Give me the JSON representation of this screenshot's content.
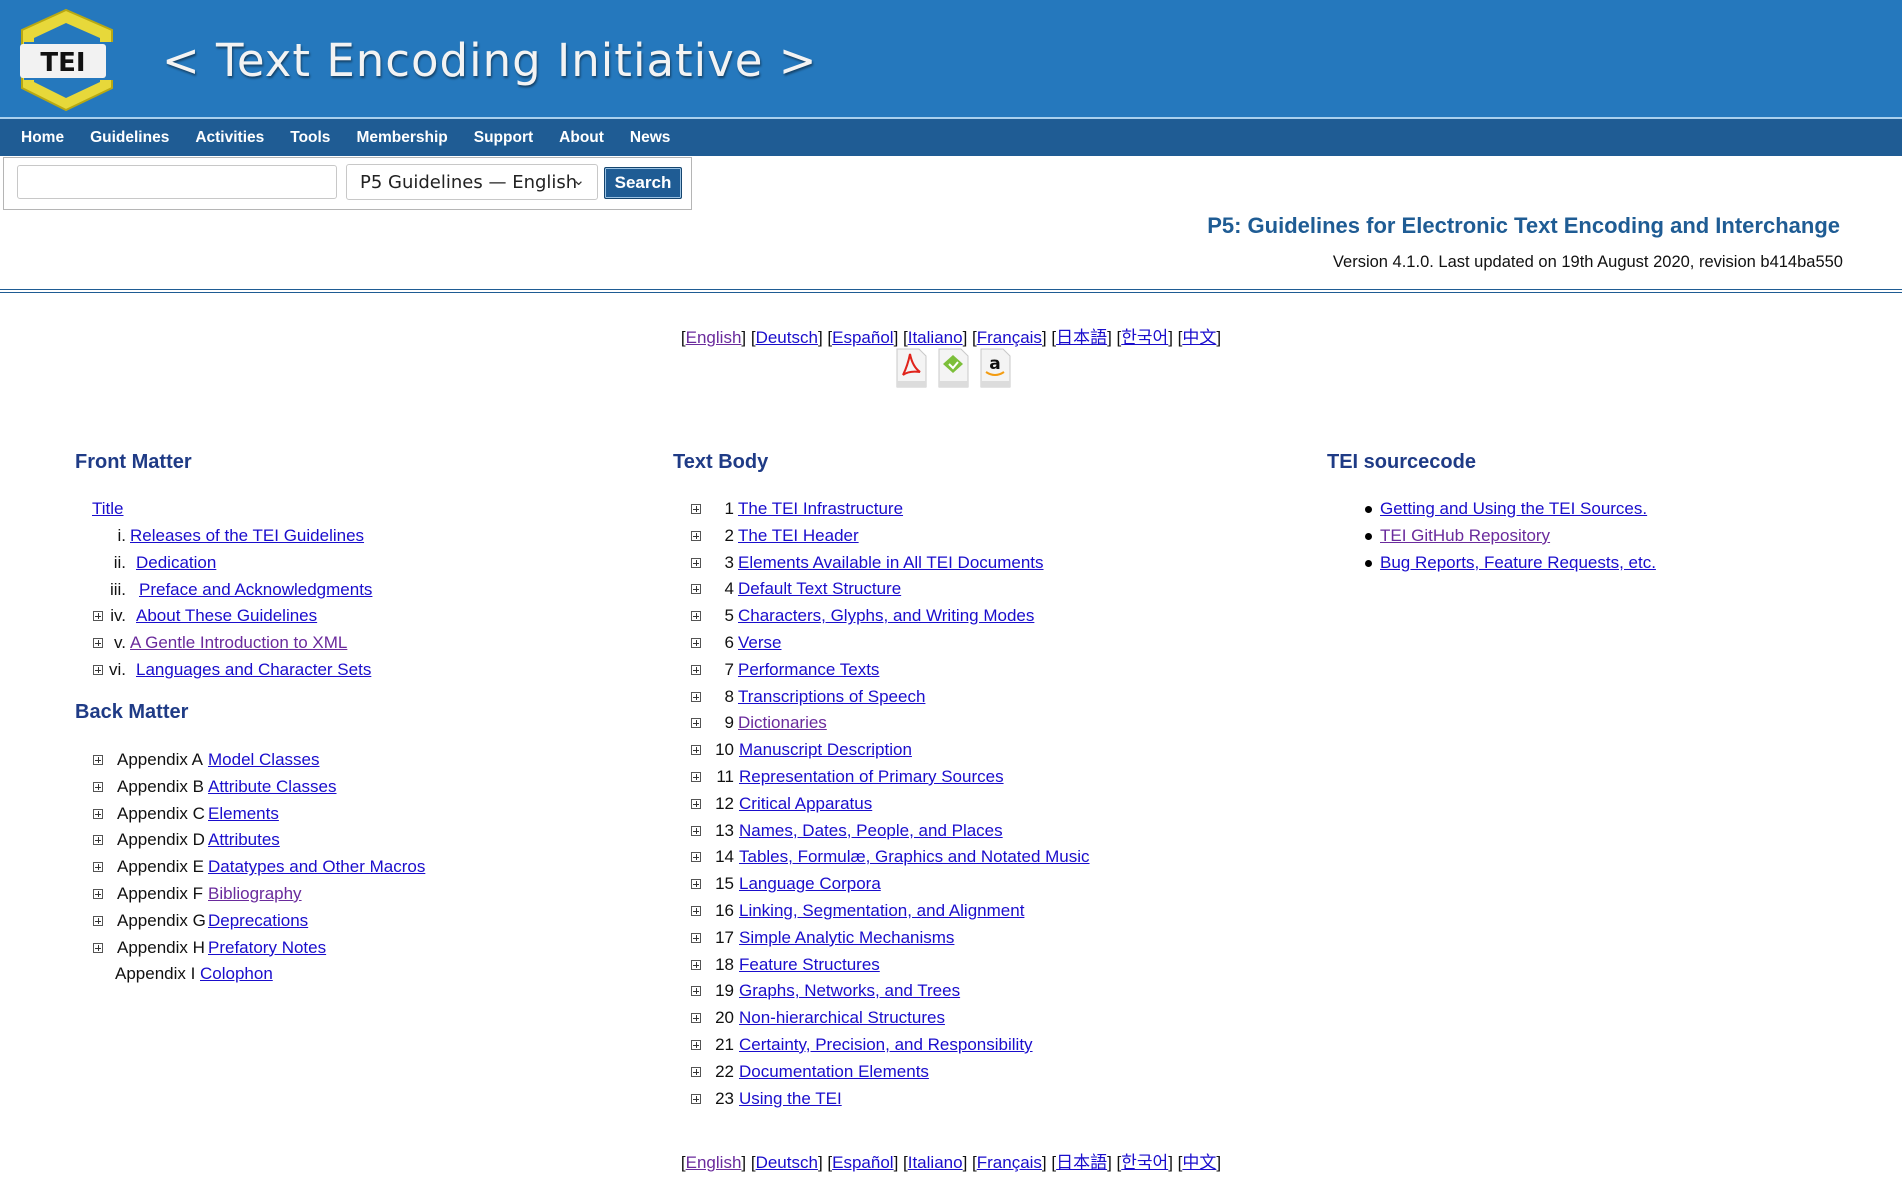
{
  "banner": {
    "logo_text": "TEI",
    "site_title": "< Text Encoding Initiative >"
  },
  "nav": {
    "items": [
      "Home",
      "Guidelines",
      "Activities",
      "Tools",
      "Membership",
      "Support",
      "About",
      "News"
    ]
  },
  "search": {
    "input_value": "",
    "select_value": "P5 Guidelines — English",
    "button_label": "Search"
  },
  "header": {
    "title": "P5: Guidelines for Electronic Text Encoding and Interchange",
    "version": "Version 4.1.0. Last updated on 19th August 2020, revision b414ba550"
  },
  "languages": [
    "English",
    "Deutsch",
    "Español",
    "Italiano",
    "Français",
    "日本語",
    "한국어",
    "中文"
  ],
  "downloads": [
    {
      "icon": "pdf-icon"
    },
    {
      "icon": "epub-icon"
    },
    {
      "icon": "amazon-icon"
    }
  ],
  "front_matter": {
    "heading": "Front Matter",
    "title_link": "Title",
    "items": [
      {
        "num": "i.",
        "label": "Releases of the TEI Guidelines",
        "expandable": false
      },
      {
        "num": "ii.",
        "label": "Dedication",
        "expandable": false
      },
      {
        "num": "iii.",
        "label": "Preface and Acknowledgments",
        "expandable": false
      },
      {
        "num": "iv.",
        "label": "About These Guidelines",
        "expandable": true
      },
      {
        "num": "v.",
        "label": "A Gentle Introduction to XML",
        "expandable": true
      },
      {
        "num": "vi.",
        "label": "Languages and Character Sets",
        "expandable": true
      }
    ]
  },
  "back_matter": {
    "heading": "Back Matter",
    "items": [
      {
        "num": "Appendix A",
        "label": "Model Classes",
        "expandable": true
      },
      {
        "num": "Appendix B",
        "label": "Attribute Classes",
        "expandable": true
      },
      {
        "num": "Appendix C",
        "label": "Elements",
        "expandable": true
      },
      {
        "num": "Appendix D",
        "label": "Attributes",
        "expandable": true
      },
      {
        "num": "Appendix E",
        "label": "Datatypes and Other Macros",
        "expandable": true
      },
      {
        "num": "Appendix F",
        "label": "Bibliography",
        "expandable": true
      },
      {
        "num": "Appendix G",
        "label": "Deprecations",
        "expandable": true
      },
      {
        "num": "Appendix H",
        "label": "Prefatory Notes",
        "expandable": true
      },
      {
        "num": "Appendix I",
        "label": "Colophon",
        "expandable": false
      }
    ]
  },
  "text_body": {
    "heading": "Text Body",
    "items": [
      {
        "num": "1",
        "label": "The TEI Infrastructure"
      },
      {
        "num": "2",
        "label": "The TEI Header"
      },
      {
        "num": "3",
        "label": "Elements Available in All TEI Documents"
      },
      {
        "num": "4",
        "label": "Default Text Structure"
      },
      {
        "num": "5",
        "label": "Characters, Glyphs, and Writing Modes"
      },
      {
        "num": "6",
        "label": "Verse"
      },
      {
        "num": "7",
        "label": "Performance Texts"
      },
      {
        "num": "8",
        "label": "Transcriptions of Speech"
      },
      {
        "num": "9",
        "label": "Dictionaries"
      },
      {
        "num": "10",
        "label": "Manuscript Description"
      },
      {
        "num": "11",
        "label": "Representation of Primary Sources"
      },
      {
        "num": "12",
        "label": "Critical Apparatus"
      },
      {
        "num": "13",
        "label": "Names, Dates, People, and Places"
      },
      {
        "num": "14",
        "label": "Tables, Formulæ, Graphics and Notated Music"
      },
      {
        "num": "15",
        "label": "Language Corpora"
      },
      {
        "num": "16",
        "label": "Linking, Segmentation, and Alignment"
      },
      {
        "num": "17",
        "label": "Simple Analytic Mechanisms"
      },
      {
        "num": "18",
        "label": "Feature Structures"
      },
      {
        "num": "19",
        "label": "Graphs, Networks, and Trees"
      },
      {
        "num": "20",
        "label": "Non-hierarchical Structures"
      },
      {
        "num": "21",
        "label": "Certainty, Precision, and Responsibility"
      },
      {
        "num": "22",
        "label": "Documentation Elements"
      },
      {
        "num": "23",
        "label": "Using the TEI"
      }
    ]
  },
  "sourcecode": {
    "heading": "TEI sourcecode",
    "items": [
      {
        "label": "Getting and Using the TEI Sources."
      },
      {
        "label": "TEI GitHub Repository"
      },
      {
        "label": "Bug Reports, Feature Requests, etc."
      }
    ]
  },
  "colors": {
    "banner_blue": "#2578bd",
    "nav_blue": "#1f5c94",
    "heading_blue": "#1f3b86",
    "link": "#1a0dcc",
    "visited_link": "#6a2a9c"
  }
}
